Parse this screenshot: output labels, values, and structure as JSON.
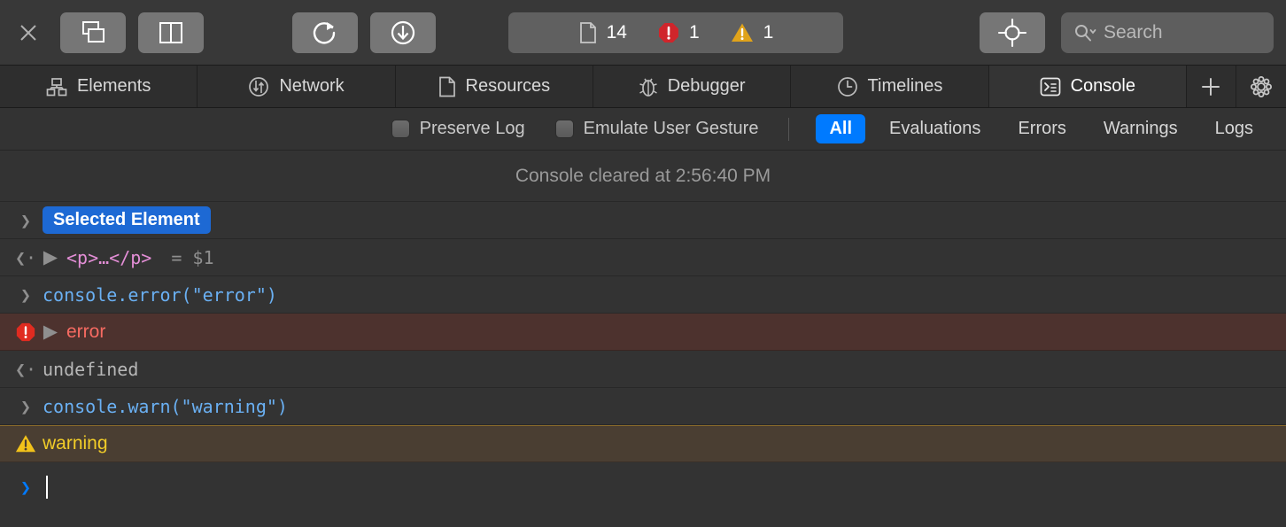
{
  "toolbar": {
    "close_label": "close-inspector",
    "buttons": [
      {
        "name": "dock-detached-button",
        "icon": "windows-overlap-icon"
      },
      {
        "name": "dock-side-button",
        "icon": "split-pane-icon"
      },
      {
        "name": "reload-button",
        "icon": "reload-circular-arrow-icon"
      },
      {
        "name": "download-button",
        "icon": "download-circle-arrow-icon"
      }
    ],
    "counters": [
      {
        "name": "resources-count",
        "icon": "document-icon",
        "value": "14"
      },
      {
        "name": "errors-count",
        "icon": "error-octagon-icon",
        "value": "1"
      },
      {
        "name": "warnings-count",
        "icon": "warning-triangle-icon",
        "value": "1"
      }
    ],
    "inspect_button": {
      "name": "element-picker-button",
      "icon": "crosshair-target-icon"
    },
    "search": {
      "placeholder": "Search",
      "value": "",
      "icon": "search-magnifier-icon"
    }
  },
  "tabs": [
    {
      "label": "Elements",
      "icon": "dom-tree-icon",
      "active": false
    },
    {
      "label": "Network",
      "icon": "network-arrows-icon",
      "active": false
    },
    {
      "label": "Resources",
      "icon": "document-icon",
      "active": false
    },
    {
      "label": "Debugger",
      "icon": "bug-icon",
      "active": false
    },
    {
      "label": "Timelines",
      "icon": "clock-icon",
      "active": false
    },
    {
      "label": "Console",
      "icon": "terminal-prompt-icon",
      "active": true
    }
  ],
  "tab_actions": [
    {
      "name": "add-tab-button",
      "icon": "plus-icon"
    },
    {
      "name": "settings-button",
      "icon": "gear-icon"
    }
  ],
  "filter_bar": {
    "checkboxes": [
      {
        "label": "Preserve Log",
        "checked": false
      },
      {
        "label": "Emulate User Gesture",
        "checked": false
      }
    ],
    "filters": [
      {
        "label": "All",
        "active": true
      },
      {
        "label": "Evaluations",
        "active": false
      },
      {
        "label": "Errors",
        "active": false
      },
      {
        "label": "Warnings",
        "active": false
      },
      {
        "label": "Logs",
        "active": false
      }
    ]
  },
  "console": {
    "cleared_message": "Console cleared at 2:56:40 PM",
    "rows": [
      {
        "type": "selected-element",
        "badge": "Selected Element",
        "prompt": "❯"
      },
      {
        "type": "result-node",
        "prompt": "❮·",
        "disclosure": "▶",
        "markup": "<p>…</p>",
        "assignment": "=  $1"
      },
      {
        "type": "input",
        "prompt": "❯",
        "text": "console.error(\"error\")"
      },
      {
        "type": "error",
        "icon": "error-octagon-icon",
        "disclosure": "▶",
        "text": "error"
      },
      {
        "type": "result",
        "prompt": "❮·",
        "text": "undefined"
      },
      {
        "type": "input",
        "prompt": "❯",
        "text": "console.warn(\"warning\")"
      },
      {
        "type": "warning",
        "icon": "warning-triangle-icon",
        "text": "warning"
      },
      {
        "type": "prompt",
        "prompt": "❯",
        "text": ""
      }
    ]
  },
  "colors": {
    "accent_blue": "#007aff",
    "badge_blue": "#1d69d4",
    "error_red": "#f76b62",
    "error_bg": "#4d322e",
    "warning_yellow": "#f2cd28",
    "warning_bg": "#4a3e32",
    "input_blue": "#6ab0f3",
    "tag_pink": "#e38ed6"
  }
}
